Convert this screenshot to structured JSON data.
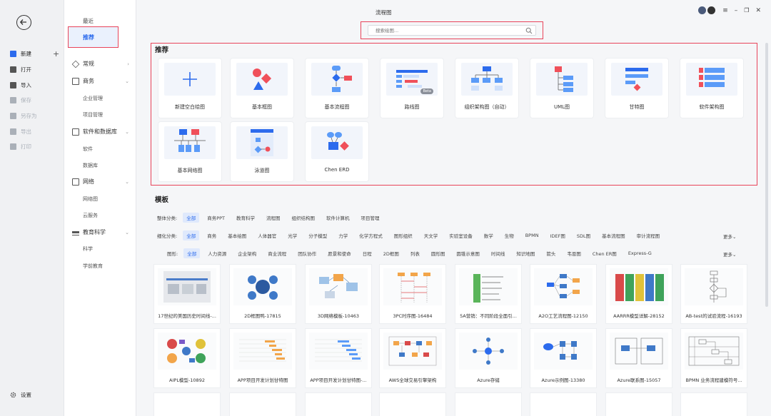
{
  "left_panel": {
    "items": [
      {
        "label": "新建",
        "icon": "new-icon"
      },
      {
        "label": "打开",
        "icon": "folder-icon"
      },
      {
        "label": "导入",
        "icon": "import-icon"
      },
      {
        "label": "保存",
        "icon": "save-icon"
      },
      {
        "label": "另存为",
        "icon": "save-as-icon"
      },
      {
        "label": "导出",
        "icon": "export-icon"
      },
      {
        "label": "打印",
        "icon": "print-icon"
      }
    ],
    "settings_label": "设置"
  },
  "nav": {
    "recent": "最近",
    "recommended": "推荐",
    "categories": [
      {
        "label": "常规",
        "children": []
      },
      {
        "label": "商务",
        "children": [
          "企业管理",
          "项目管理"
        ]
      },
      {
        "label": "软件和数据库",
        "children": [
          "软件",
          "数据库"
        ]
      },
      {
        "label": "网络",
        "children": [
          "网络图",
          "云服务"
        ]
      },
      {
        "label": "教育科学",
        "children": [
          "科学",
          "学前教育"
        ]
      }
    ]
  },
  "header": {
    "title": "流程图",
    "search_placeholder": "搜索绘图...",
    "window_controls": [
      "≡",
      "–",
      "❐",
      "✕"
    ]
  },
  "recommended": {
    "heading": "推荐",
    "cards": [
      {
        "label": "新建空白绘图"
      },
      {
        "label": "基本框图"
      },
      {
        "label": "基本流程图"
      },
      {
        "label": "路线图",
        "badge": "Beta"
      },
      {
        "label": "组织架构图（自动）"
      },
      {
        "label": "UML图"
      },
      {
        "label": "甘特图"
      },
      {
        "label": "软件架构图"
      },
      {
        "label": "基本网络图"
      },
      {
        "label": "泳道图"
      },
      {
        "label": "Chen ERD"
      }
    ]
  },
  "templates": {
    "heading": "模板",
    "filter_rows": [
      {
        "label": "整体分类:",
        "chips": [
          "全部",
          "商务PPT",
          "教育科学",
          "流程图",
          "组织结构图",
          "软件计算机",
          "项目管理"
        ],
        "more": ""
      },
      {
        "label": "细化分类:",
        "chips": [
          "全部",
          "商务",
          "基本绘图",
          "人体器官",
          "光学",
          "分子模型",
          "力学",
          "化学方程式",
          "图形组织",
          "天文学",
          "实验室设备",
          "数学",
          "生物",
          "BPMN",
          "IDEF图",
          "SDL图",
          "基本流程图",
          "审计流程图"
        ],
        "more": "更多⌄"
      },
      {
        "label": "图形:",
        "chips": [
          "全部",
          "人力资源",
          "企业架构",
          "商业流程",
          "团队协作",
          "愿景和使命",
          "日程",
          "2D框图",
          "列表",
          "圆形图",
          "圆锥示意图",
          "时间线",
          "知识地图",
          "箭头",
          "韦恩图",
          "Chen ER图",
          "Express-G"
        ],
        "more": "更多⌄"
      }
    ],
    "cards": [
      {
        "label": "17世纪的美国历史时间线-..."
      },
      {
        "label": "2D框图鸭-17815"
      },
      {
        "label": "3D网络模板-10463"
      },
      {
        "label": "3PC时序图-16484"
      },
      {
        "label": "5A营销：不同阶段全面引..."
      },
      {
        "label": "A2O工艺流程图-12150"
      },
      {
        "label": "AARRR模型详解-28152"
      },
      {
        "label": "AB-test的试验流程-16193"
      },
      {
        "label": "AIPL模型-10892"
      },
      {
        "label": "APP项目开发计划甘特图"
      },
      {
        "label": "APP项目开发计划甘特图-..."
      },
      {
        "label": "AWS全球交易引擎架构"
      },
      {
        "label": "Azure存储"
      },
      {
        "label": "Azure示例图-13380"
      },
      {
        "label": "Azure联系图-15057"
      },
      {
        "label": "BPMN 业务流程建模符号..."
      }
    ]
  },
  "colors": {
    "accent": "#2c6bed",
    "highlight_border": "#e8445a",
    "red": "#f0505a"
  }
}
